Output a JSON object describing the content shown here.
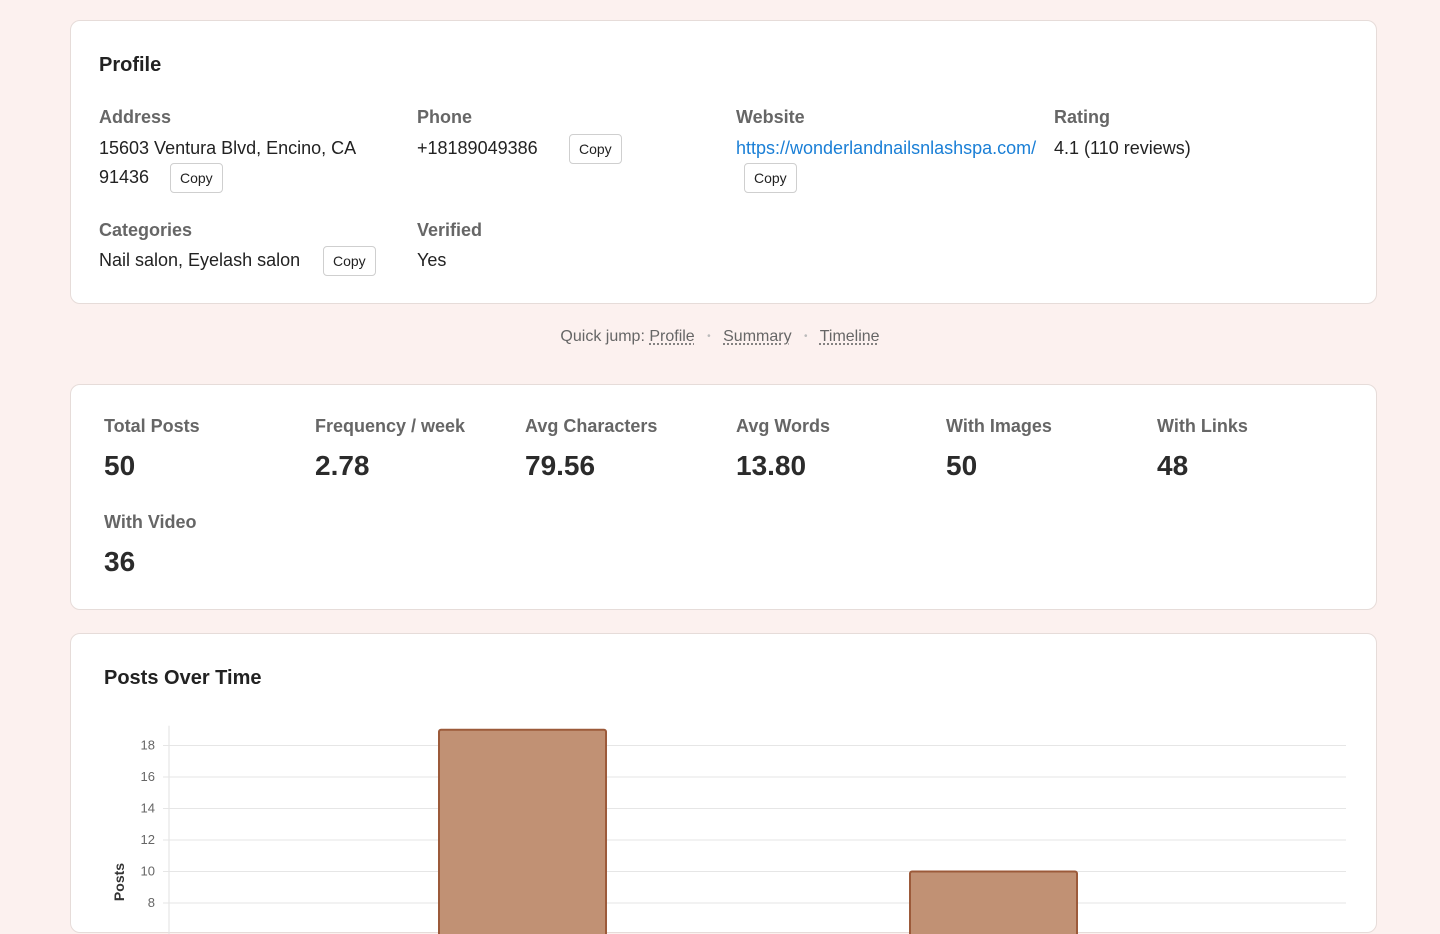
{
  "profile": {
    "title": "Profile",
    "address": {
      "label": "Address",
      "line1": "15603 Ventura Blvd, Encino, CA",
      "line2": "91436"
    },
    "phone": {
      "label": "Phone",
      "value": "+18189049386"
    },
    "website": {
      "label": "Website",
      "value": "https://wonderlandnailsnlashspa.com/"
    },
    "rating": {
      "label": "Rating",
      "value": "4.1 (110 reviews)"
    },
    "categories": {
      "label": "Categories",
      "value": "Nail salon, Eyelash salon"
    },
    "verified": {
      "label": "Verified",
      "value": "Yes"
    },
    "copy_label": "Copy"
  },
  "quick_jump": {
    "prefix": "Quick jump:",
    "links": [
      "Profile",
      "Summary",
      "Timeline"
    ],
    "separator": "•"
  },
  "summary": {
    "stats": [
      {
        "label": "Total Posts",
        "value": "50"
      },
      {
        "label": "Frequency / week",
        "value": "2.78"
      },
      {
        "label": "Avg Characters",
        "value": "79.56"
      },
      {
        "label": "Avg Words",
        "value": "13.80"
      },
      {
        "label": "With Images",
        "value": "50"
      },
      {
        "label": "With Links",
        "value": "48"
      },
      {
        "label": "With Video",
        "value": "36"
      }
    ]
  },
  "chart": {
    "title": "Posts Over Time"
  },
  "chart_data": {
    "type": "bar",
    "ylabel": "Posts",
    "ylim": [
      0,
      19
    ],
    "yticks": [
      8,
      10,
      12,
      14,
      16,
      18
    ],
    "grid": true,
    "values": [
      19,
      10
    ],
    "bar_color": "#c19174",
    "bar_border": "#9c5a3a"
  },
  "colors": {
    "page_bg": "#fcf1ef",
    "link": "#1a7fd6"
  }
}
